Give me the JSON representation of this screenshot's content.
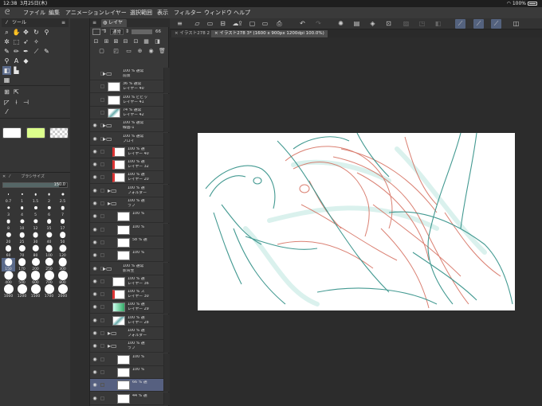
{
  "status": {
    "time": "12:38",
    "date": "3月25日(木)",
    "battery": "100%"
  },
  "menu": {
    "items": [
      "ファイル",
      "編集",
      "アニメーション",
      "レイヤー",
      "選択範囲",
      "表示",
      "フィルター",
      "ウィンドウ",
      "ヘルプ"
    ]
  },
  "tool_panel": {
    "tab_label": "ツール",
    "brush_panel_title": "ブラシサイズ",
    "brush_size_value": "150.0",
    "brush_sizes": [
      "0.7",
      "1",
      "1.5",
      "2",
      "2.5",
      "3",
      "4",
      "5",
      "6",
      "7",
      "8",
      "10",
      "12",
      "15",
      "17",
      "20",
      "25",
      "30",
      "40",
      "50",
      "60",
      "70",
      "80",
      "100",
      "120",
      "150",
      "170",
      "200",
      "250",
      "300",
      "400",
      "500",
      "600",
      "700",
      "800",
      "1000",
      "1200",
      "1500",
      "1700",
      "2000"
    ],
    "selected_brush_size": "150"
  },
  "colors": {
    "main": "#ffffff",
    "sub": "#dcff8c",
    "accent": "#566080"
  },
  "layer_panel": {
    "tab_label": "レイヤー",
    "blend_mode": "通常",
    "opacity": "66",
    "layers": [
      {
        "type": "folder",
        "line1": "100 % 通常",
        "line2": "前景",
        "indent": 0
      },
      {
        "type": "layer",
        "line1": "36 % 通常",
        "line2": "レイヤー 40",
        "indent": 0,
        "thumb": "plain"
      },
      {
        "type": "layer",
        "line1": "100 % ビビッ",
        "line2": "レイヤー 41",
        "indent": 0,
        "thumb": "plain"
      },
      {
        "type": "layer",
        "line1": "74 % 通常",
        "line2": "レイヤー 42",
        "indent": 0,
        "thumb": "teal"
      },
      {
        "type": "folder",
        "line1": "100 % 通常",
        "line2": "線画-1",
        "indent": 0
      },
      {
        "type": "folder",
        "line1": "100 % 通常",
        "line2": "ブロイ",
        "indent": 0
      },
      {
        "type": "layer",
        "line1": "100 % 通",
        "line2": "レイヤー 40",
        "indent": 1,
        "thumb": "red"
      },
      {
        "type": "layer",
        "line1": "100 % 通",
        "line2": "レイヤー 32",
        "indent": 1,
        "thumb": "red"
      },
      {
        "type": "layer",
        "line1": "100 % 通",
        "line2": "レイヤー 20",
        "indent": 1,
        "thumb": "red"
      },
      {
        "type": "folder",
        "line1": "100 % 通",
        "line2": "フォルダー",
        "indent": 1
      },
      {
        "type": "folder",
        "line1": "100 % 通",
        "line2": "ラフ",
        "indent": 1
      },
      {
        "type": "layer",
        "line1": "100 %",
        "line2": "",
        "indent": 2,
        "thumb": "plain"
      },
      {
        "type": "layer",
        "line1": "100 %",
        "line2": "",
        "indent": 2,
        "thumb": "plain"
      },
      {
        "type": "layer",
        "line1": "58 % 通",
        "line2": "",
        "indent": 2,
        "thumb": "plain"
      },
      {
        "type": "layer",
        "line1": "100 %",
        "line2": "",
        "indent": 2,
        "thumb": "plain"
      },
      {
        "type": "folder",
        "line1": "100 % 通常",
        "line2": "影背生",
        "indent": 0
      },
      {
        "type": "layer",
        "line1": "100 % 通",
        "line2": "レイヤー 36",
        "indent": 1,
        "thumb": "plain"
      },
      {
        "type": "layer",
        "line1": "100 % ス",
        "line2": "レイヤー 30",
        "indent": 1,
        "thumb": "red"
      },
      {
        "type": "layer",
        "line1": "100 % 通",
        "line2": "レイヤー 29",
        "indent": 1,
        "thumb": "grad"
      },
      {
        "type": "layer",
        "line1": "100 % 通",
        "line2": "レイヤー 28",
        "indent": 1,
        "thumb": "teal"
      },
      {
        "type": "folder",
        "line1": "100 % 通",
        "line2": "フォルダー",
        "indent": 1
      },
      {
        "type": "folder",
        "line1": "100 % 通",
        "line2": "ラフ",
        "indent": 1
      },
      {
        "type": "layer",
        "line1": "100 %",
        "line2": "",
        "indent": 2,
        "thumb": "plain"
      },
      {
        "type": "layer",
        "line1": "100 %",
        "line2": "",
        "indent": 2,
        "thumb": "plain"
      },
      {
        "type": "layer",
        "line1": "66 % 通",
        "line2": "",
        "indent": 2,
        "thumb": "plain",
        "selected": true
      },
      {
        "type": "layer",
        "line1": "44 % 通",
        "line2": "",
        "indent": 2,
        "thumb": "plain"
      }
    ]
  },
  "canvas": {
    "tabs": [
      {
        "label": "イラスト278 2",
        "active": false
      },
      {
        "label": "イラスト278 3* (1600 x 900px 1200dpi 100.0%)",
        "active": true
      }
    ]
  }
}
